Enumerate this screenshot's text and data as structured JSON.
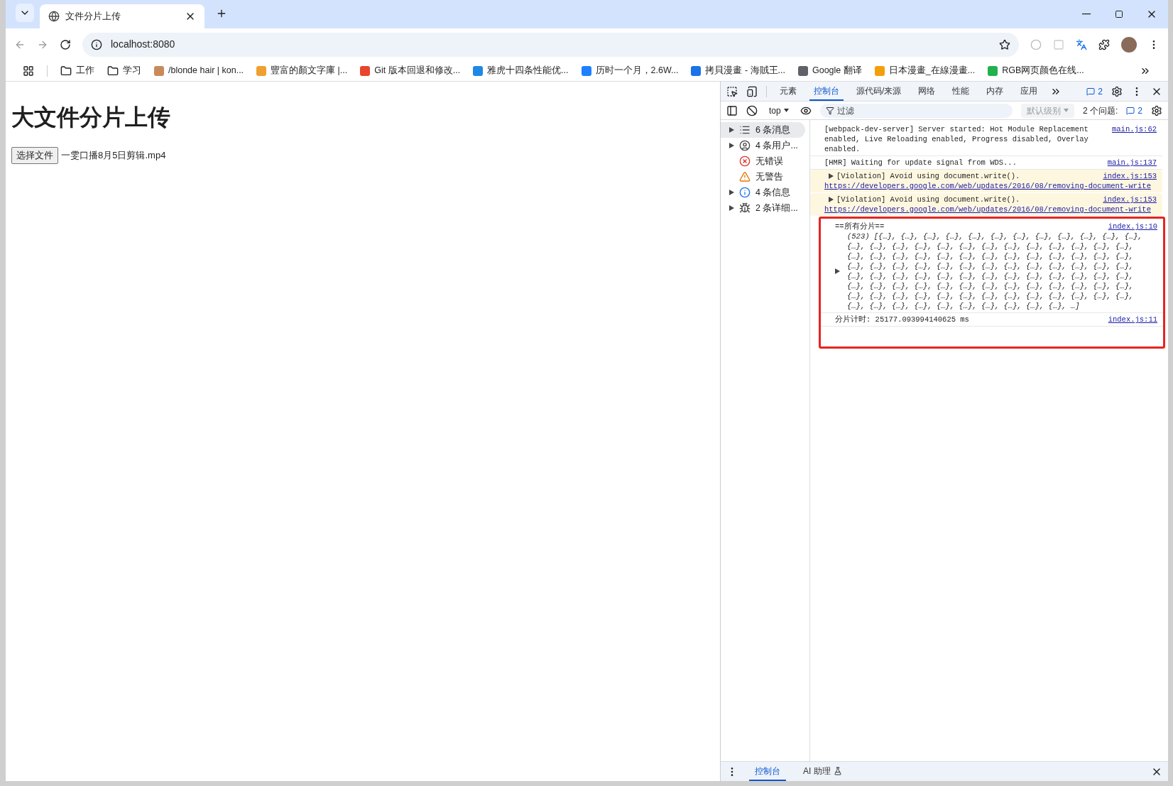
{
  "browser": {
    "tabs": [
      {
        "title": "文件分片上传",
        "selected": true
      }
    ],
    "address_bar": {
      "url": "localhost:8080"
    },
    "bookmarks": [
      {
        "label": "工作",
        "kind": "folder"
      },
      {
        "label": "学习",
        "kind": "folder"
      },
      {
        "label": "/blonde hair | kon...",
        "kind": "site",
        "color": "#c98a5a"
      },
      {
        "label": "豐富的顏文字庫 |...",
        "kind": "site",
        "color": "#f0a030"
      },
      {
        "label": "Git 版本回退和修改...",
        "kind": "site",
        "color": "#e8452c"
      },
      {
        "label": "雅虎十四条性能优...",
        "kind": "site",
        "color": "#1e88e5"
      },
      {
        "label": "历时一个月，2.6W...",
        "kind": "site",
        "color": "#1e80ff"
      },
      {
        "label": "拷貝漫畫 - 海賊王...",
        "kind": "site",
        "color": "#1a73e8"
      },
      {
        "label": "Google 翻译",
        "kind": "site",
        "color": "#5f6368"
      },
      {
        "label": "日本漫畫_在線漫畫...",
        "kind": "site",
        "color": "#f59e0b"
      },
      {
        "label": "RGB网页颜色在线...",
        "kind": "site",
        "color": "#22b14c"
      }
    ]
  },
  "page": {
    "heading": "大文件分片上传",
    "file_button": "选择文件",
    "file_name": "一雯口播8月5日剪辑.mp4"
  },
  "devtools": {
    "tabs": [
      {
        "label": "元素",
        "selected": false
      },
      {
        "label": "控制台",
        "selected": true
      },
      {
        "label": "源代码/来源",
        "selected": false
      },
      {
        "label": "网络",
        "selected": false
      },
      {
        "label": "性能",
        "selected": false
      },
      {
        "label": "内存",
        "selected": false
      },
      {
        "label": "应用",
        "selected": false
      }
    ],
    "issues_badge": "2",
    "context": "top",
    "filter_placeholder": "过滤",
    "level_filter": {
      "label": "默认级别",
      "disabled": true
    },
    "issues_label": "2 个问题:",
    "issues_count": "2",
    "sidebar": [
      {
        "label": "6 条消息",
        "kind": "messages",
        "expandable": true,
        "selected": true
      },
      {
        "label": "4 条用户...",
        "kind": "user",
        "expandable": true,
        "selected": false
      },
      {
        "label": "无错误",
        "kind": "error",
        "expandable": false,
        "selected": false
      },
      {
        "label": "无警告",
        "kind": "warning",
        "expandable": false,
        "selected": false
      },
      {
        "label": "4 条信息",
        "kind": "info",
        "expandable": true,
        "selected": false
      },
      {
        "label": "2 条详细...",
        "kind": "verbose",
        "expandable": true,
        "selected": false
      }
    ],
    "messages": [
      {
        "kind": "log",
        "text": "[webpack-dev-server] Server started: Hot Module Replacement enabled, Live Reloading enabled, Progress disabled, Overlay enabled.",
        "source": "main.js:62",
        "highlighted": false
      },
      {
        "kind": "log",
        "text": "[HMR] Waiting for update signal from WDS...",
        "source": "main.js:137",
        "highlighted": false
      },
      {
        "kind": "violation",
        "text": "[Violation] Avoid using document.write().",
        "link": "https://developers.google.com/web/updates/2016/08/removing-document-write",
        "source": "index.js:153",
        "highlighted": false
      },
      {
        "kind": "violation",
        "text": "[Violation] Avoid using document.write().",
        "link": "https://developers.google.com/web/updates/2016/08/removing-document-write",
        "source": "index.js:153",
        "highlighted": false
      },
      {
        "kind": "array",
        "text": "==所有分片==",
        "preview": "(523) [{…}, {…}, {…}, {…}, {…}, {…}, {…}, {…}, {…}, {…}, {…}, {…}, {…}, {…}, {…}, {…}, {…}, {…}, {…}, {…}, {…}, {…}, {…}, {…}, {…}, {…}, {…}, {…}, {…}, {…}, {…}, {…}, {…}, {…}, {…}, {…}, {…}, {…}, {…}, {…}, {…}, {…}, {…}, {…}, {…}, {…}, {…}, {…}, {…}, {…}, {…}, {…}, {…}, {…}, {…}, {…}, {…}, {…}, {…}, {…}, {…}, {…}, {…}, {…}, {…}, {…}, {…}, {…}, {…}, {…}, {…}, {…}, {…}, {…}, {…}, {…}, {…}, {…}, {…}, {…}, {…}, {…}, {…}, {…}, {…}, {…}, {…}, {…}, {…}, {…}, {…}, {…}, {…}, {…}, {…}, {…}, {…}, {…}, {…}, {…}, …]",
        "source": "index.js:10",
        "highlighted": true
      },
      {
        "kind": "log",
        "text": "分片计时: 25177.093994140625 ms",
        "source": "index.js:11",
        "highlighted": true
      }
    ],
    "drawer_tabs": [
      {
        "label": "控制台",
        "selected": true
      },
      {
        "label": "AI 助理",
        "selected": false
      }
    ]
  }
}
